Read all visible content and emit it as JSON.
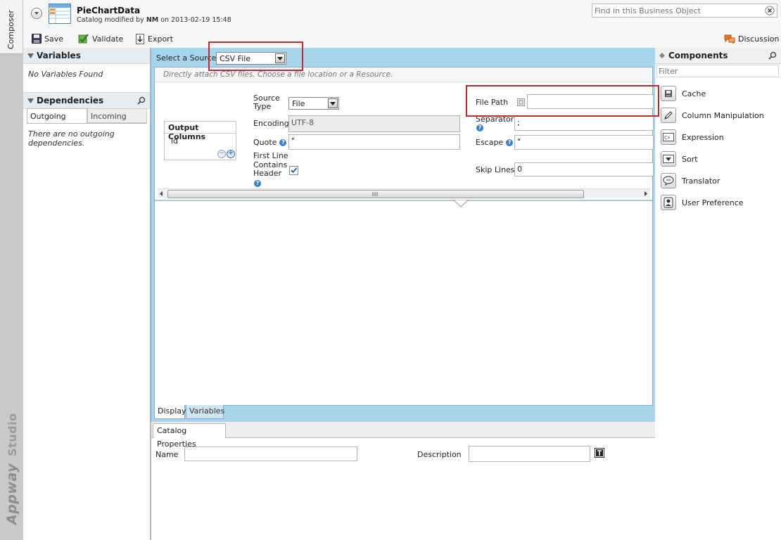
{
  "rail": {
    "tab_label": "Composer",
    "brand_1": "Appway",
    "brand_2": "Studio"
  },
  "header": {
    "title": "PieChartData",
    "subtitle_prefix": "Catalog modified by",
    "author": "NM",
    "subtitle_mid": "on",
    "timestamp": "2013-02-19 15:48",
    "search_placeholder": "Find in this Business Object",
    "toolbar": {
      "save": "Save",
      "validate": "Validate",
      "export": "Export",
      "discussion": "Discussion"
    }
  },
  "left": {
    "variables_title": "Variables",
    "no_variables": "No Variables Found",
    "dependencies_title": "Dependencies",
    "tab_outgoing": "Outgoing",
    "tab_incoming": "Incoming",
    "no_outgoing": "There are no outgoing dependencies."
  },
  "main": {
    "select_source_label": "Select a Source",
    "select_source_value": "CSV File",
    "hint": "Directly attach CSV files. Choose a file location or a Resource.",
    "output_columns_title": "Output Columns",
    "output_columns": [
      "id"
    ],
    "source_type_label": "Source Type",
    "source_type_value": "File",
    "encoding_label": "Encoding",
    "encoding_value": "UTF-8",
    "quote_label": "Quote",
    "quote_value": "\"",
    "first_line_label": "First Line Contains Header",
    "first_line_checked": true,
    "file_path_label": "File Path",
    "file_path_value": "",
    "separator_label": "Separator",
    "separator_value": ";",
    "escape_label": "Escape",
    "escape_value": "\"",
    "skip_lines_label": "Skip Lines",
    "skip_lines_value": "0",
    "tab_display": "Display",
    "tab_variables": "Variables"
  },
  "bottom": {
    "tab_catalog_properties": "Catalog Properties",
    "name_label": "Name",
    "name_value": "",
    "description_label": "Description",
    "description_value": ""
  },
  "right": {
    "components_title": "Components",
    "filter_placeholder": "Filter",
    "items": [
      {
        "label": "Cache",
        "icon": "cache-icon"
      },
      {
        "label": "Column Manipulation",
        "icon": "pencil-icon"
      },
      {
        "label": "Expression",
        "icon": "expression-icon"
      },
      {
        "label": "Sort",
        "icon": "sort-icon"
      },
      {
        "label": "Translator",
        "icon": "speech-bubble-icon"
      },
      {
        "label": "User Preference",
        "icon": "user-preference-icon"
      }
    ]
  },
  "colors": {
    "accent_blue": "#a8d4ec",
    "highlight_red": "#c02a2a",
    "rail_grey": "#c9c9c9"
  }
}
